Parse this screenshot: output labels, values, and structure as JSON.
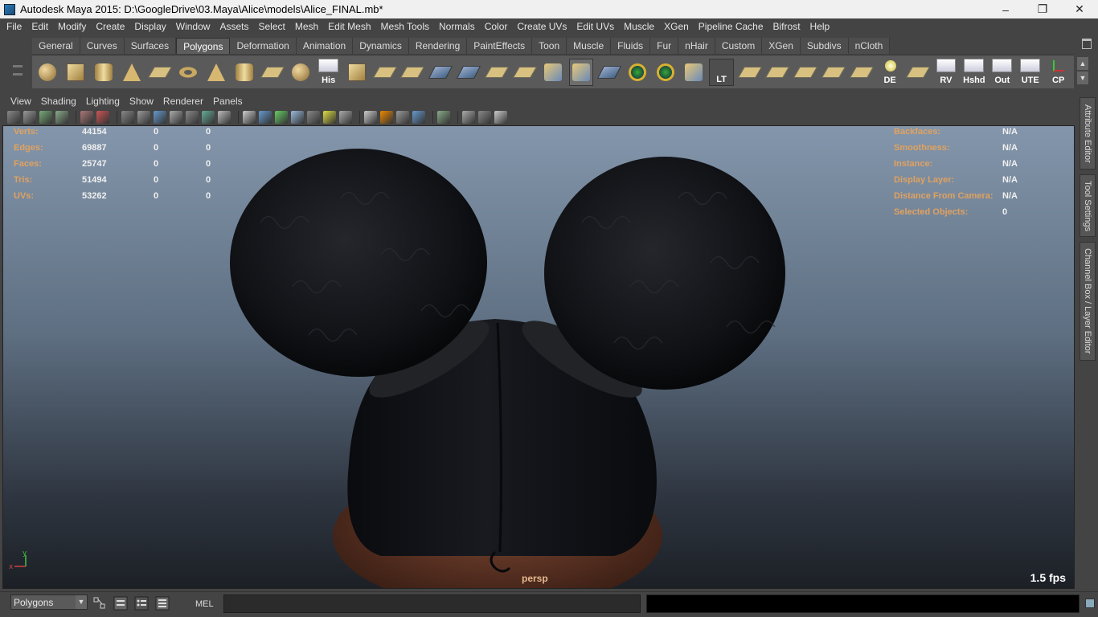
{
  "window": {
    "title": "Autodesk Maya 2015: D:\\GoogleDrive\\03.Maya\\Alice\\models\\Alice_FINAL.mb*",
    "minimize": "–",
    "restore": "❐",
    "close": "✕"
  },
  "menubar": [
    "File",
    "Edit",
    "Modify",
    "Create",
    "Display",
    "Window",
    "Assets",
    "Select",
    "Mesh",
    "Edit Mesh",
    "Mesh Tools",
    "Normals",
    "Color",
    "Create UVs",
    "Edit UVs",
    "Muscle",
    "XGen",
    "Pipeline Cache",
    "Bifrost",
    "Help"
  ],
  "shelf": {
    "tabs": [
      "General",
      "Curves",
      "Surfaces",
      "Polygons",
      "Deformation",
      "Animation",
      "Dynamics",
      "Rendering",
      "PaintEffects",
      "Toon",
      "Muscle",
      "Fluids",
      "Fur",
      "nHair",
      "Custom",
      "XGen",
      "Subdivs",
      "nCloth"
    ],
    "active_tab": "Polygons",
    "icons": [
      {
        "name": "poly-sphere-icon",
        "shape": "sphere",
        "label": ""
      },
      {
        "name": "poly-cube-icon",
        "shape": "cube",
        "label": ""
      },
      {
        "name": "poly-cylinder-icon",
        "shape": "cyl",
        "label": ""
      },
      {
        "name": "poly-cone-icon",
        "shape": "cone",
        "label": ""
      },
      {
        "name": "poly-plane-icon",
        "shape": "plane",
        "label": ""
      },
      {
        "name": "poly-torus-icon",
        "shape": "torus",
        "label": ""
      },
      {
        "name": "poly-pyramid-icon",
        "shape": "cone",
        "label": ""
      },
      {
        "name": "poly-pipe-icon",
        "shape": "cyl",
        "label": ""
      },
      {
        "name": "poly-helix-icon",
        "shape": "plane",
        "label": ""
      },
      {
        "name": "poly-soccerball-icon",
        "shape": "sphere",
        "label": ""
      },
      {
        "name": "history-icon",
        "shape": "label",
        "label": "His"
      },
      {
        "name": "extrude-icon",
        "shape": "cube",
        "label": ""
      },
      {
        "name": "bridge-icon",
        "shape": "plane",
        "label": ""
      },
      {
        "name": "append-polygon-icon",
        "shape": "plane",
        "label": ""
      },
      {
        "name": "split-polygon-icon",
        "shape": "flat",
        "label": ""
      },
      {
        "name": "insert-edge-loop-icon",
        "shape": "flat",
        "label": ""
      },
      {
        "name": "merge-vertices-icon",
        "shape": "plane",
        "label": ""
      },
      {
        "name": "smooth-icon",
        "shape": "plane",
        "label": ""
      },
      {
        "name": "cone-pointer-icon",
        "shape": "tool",
        "label": ""
      },
      {
        "name": "sculpt-brush-icon",
        "shape": "tool",
        "label": "",
        "pressed": true
      },
      {
        "name": "wire-cage-icon",
        "shape": "flat",
        "label": ""
      },
      {
        "name": "soft-select-icon",
        "shape": "ring",
        "label": ""
      },
      {
        "name": "rotate-pivot-icon",
        "shape": "ring",
        "label": ""
      },
      {
        "name": "transfer-attributes-icon",
        "shape": "tool",
        "label": ""
      },
      {
        "name": "lt-icon",
        "shape": "text",
        "label": "LT"
      },
      {
        "name": "uv-layout-icon",
        "shape": "plane",
        "label": ""
      },
      {
        "name": "uv-unfold-icon",
        "shape": "plane",
        "label": ""
      },
      {
        "name": "uv-planar-icon",
        "shape": "plane",
        "label": ""
      },
      {
        "name": "uv-cylindrical-icon",
        "shape": "plane",
        "label": ""
      },
      {
        "name": "uv-spherical-icon",
        "shape": "plane",
        "label": ""
      },
      {
        "name": "de-icon",
        "shape": "label-dark",
        "label": "DE"
      },
      {
        "name": "uv-snapshot-icon",
        "shape": "plane",
        "label": ""
      },
      {
        "name": "rv-icon",
        "shape": "label",
        "label": "RV"
      },
      {
        "name": "hshd-icon",
        "shape": "label",
        "label": "Hshd"
      },
      {
        "name": "out-icon",
        "shape": "label",
        "label": "Out"
      },
      {
        "name": "ute-icon",
        "shape": "label",
        "label": "UTE"
      },
      {
        "name": "cp-icon",
        "shape": "axis",
        "label": "CP"
      }
    ]
  },
  "viewport": {
    "menu": [
      "View",
      "Shading",
      "Lighting",
      "Show",
      "Renderer",
      "Panels"
    ],
    "camera": "persp",
    "fps": "1.5 fps",
    "axis_x": "x",
    "axis_y": "y",
    "hud_left": [
      {
        "label": "Verts:",
        "v1": "44154",
        "v2": "0",
        "v3": "0"
      },
      {
        "label": "Edges:",
        "v1": "69887",
        "v2": "0",
        "v3": "0"
      },
      {
        "label": "Faces:",
        "v1": "25747",
        "v2": "0",
        "v3": "0"
      },
      {
        "label": "Tris:",
        "v1": "51494",
        "v2": "0",
        "v3": "0"
      },
      {
        "label": "UVs:",
        "v1": "53262",
        "v2": "0",
        "v3": "0"
      }
    ],
    "hud_right": [
      {
        "label": "Backfaces:",
        "value": "N/A"
      },
      {
        "label": "Smoothness:",
        "value": "N/A"
      },
      {
        "label": "Instance:",
        "value": "N/A"
      },
      {
        "label": "Display Layer:",
        "value": "N/A"
      },
      {
        "label": "Distance From Camera:",
        "value": "N/A"
      },
      {
        "label": "Selected Objects:",
        "value": "0"
      }
    ]
  },
  "side_tabs": [
    "Attribute Editor",
    "Tool Settings",
    "Channel Box / Layer Editor"
  ],
  "command_line": {
    "mode": "Polygons",
    "mel_label": "MEL",
    "mel_value": ""
  },
  "colors": {
    "hud_label": "#e0a260",
    "hud_value": "#f0f0f0",
    "ui_bg": "#444444",
    "viewport_top": "#8496ab",
    "viewport_bottom": "#1c2026"
  }
}
